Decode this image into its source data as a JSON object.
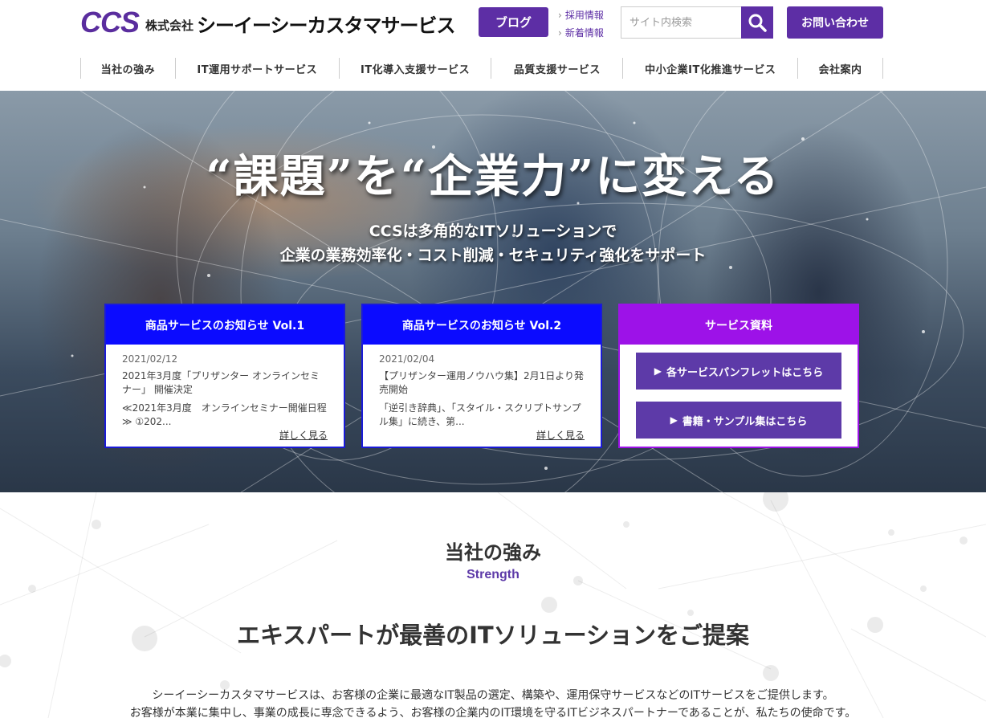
{
  "header": {
    "logo_mark": "CCS",
    "logo_kk": "株式会社",
    "logo_name": "シーイーシーカスタマサービス",
    "blog_label": "ブログ",
    "links": [
      "採用情報",
      "新着情報"
    ],
    "search_placeholder": "サイト内検索",
    "contact_label": "お問い合わせ"
  },
  "nav": {
    "items": [
      "当社の強み",
      "IT運用サポートサービス",
      "IT化導入支援サービス",
      "品質支援サービス",
      "中小企業IT化推進サービス",
      "会社案内"
    ]
  },
  "hero": {
    "title": "“課題”を“企業力”に変える",
    "sub_line1": "CCSは多角的なITソリューションで",
    "sub_line2": "企業の業務効率化・コスト削減・セキュリティ強化をサポート",
    "news": [
      {
        "head": "商品サービスのお知らせ Vol.1",
        "date": "2021/02/12",
        "title": "2021年3月度「プリザンター オンラインセミナー」 開催決定",
        "excerpt": "≪2021年3月度　オンラインセミナー開催日程≫ ①202...",
        "more": "詳しく見る"
      },
      {
        "head": "商品サービスのお知らせ Vol.2",
        "date": "2021/02/04",
        "title": "【プリザンター運用ノウハウ集】2月1日より発売開始",
        "excerpt": "「逆引き辞典」、「スタイル・スクリプトサンプル集」に続き、第...",
        "more": "詳しく見る"
      }
    ],
    "docs": {
      "head": "サービス資料",
      "btn1": "各サービスパンフレットはこちら",
      "btn2": "書籍・サンプル集はこちら"
    }
  },
  "strength": {
    "title": "当社の強み",
    "en": "Strength",
    "lead": "エキスパートが最善のITソリューションをご提案",
    "text1": "シーイーシーカスタマサービスは、お客様の企業に最適なIT製品の選定、構築や、運用保守サービスなどのITサービスをご提供します。",
    "text2": "お客様が本業に集中し、事業の成長に専念できるよう、お客様の企業内のIT環境を守るITビジネスパートナーであることが、私たちの使命です。"
  },
  "colors": {
    "brand": "#5d2ea5",
    "news_blue": "#0b0bff",
    "docs_purple": "#9d12e8",
    "docs_button": "#5d3aa8"
  },
  "icons": {
    "search": "search-icon",
    "play": "play-triangle-icon"
  }
}
